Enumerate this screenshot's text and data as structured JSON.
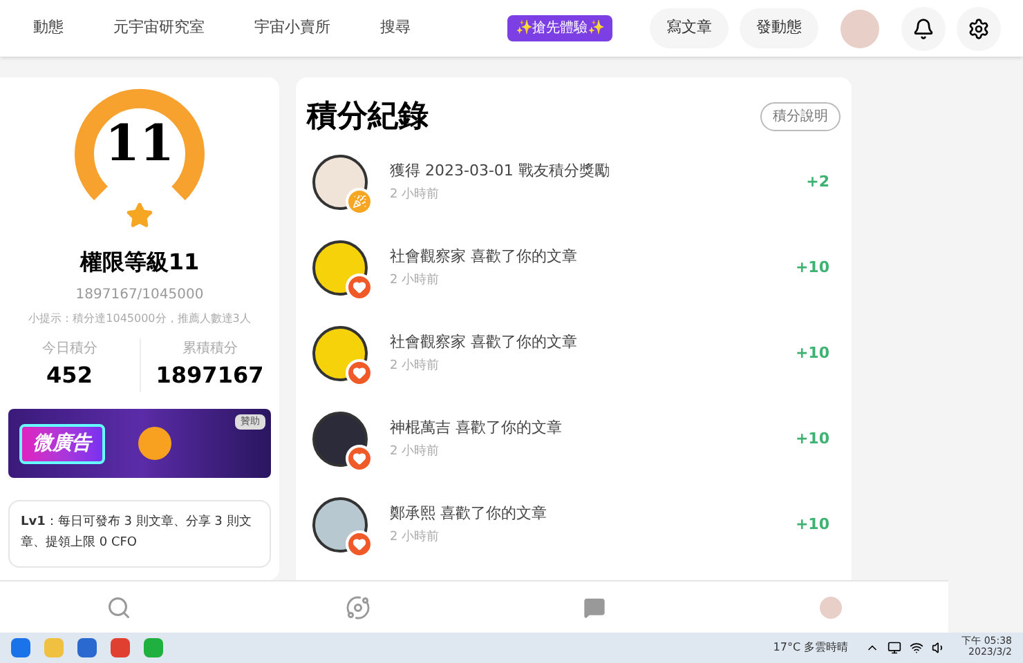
{
  "top_nav": {
    "links": [
      {
        "label": "動態",
        "selected": false
      },
      {
        "label": "元宇宙研究室",
        "selected": false
      },
      {
        "label": "宇宙小賣所",
        "selected": false
      },
      {
        "label": "搜尋",
        "selected": false
      }
    ],
    "promo_badge": "✨搶先體驗✨",
    "buttons": [
      "寫文章",
      "發動態"
    ]
  },
  "level_card": {
    "level_number": "11",
    "title": "權限等級11",
    "progress": "1897167/1045000",
    "hint": "小提示：積分達1045000分，推薦人數達3人",
    "stats": [
      {
        "label": "今日積分",
        "value": "452"
      },
      {
        "label": "累積積分",
        "value": "1897167"
      }
    ],
    "ad": {
      "title": "微廣告",
      "tag": "贊助"
    },
    "level_info": "**Lv1**：每日可發布 3 則文章、分享 3 則文章、提領上限 0 CFO"
  },
  "points_log": {
    "title": "積分紀錄",
    "help_button": "積分說明",
    "entries": [
      {
        "kind": "reward",
        "text": "獲得 2023-03-01 戰友積分獎勵",
        "time": "2 小時前",
        "points": "+2"
      },
      {
        "kind": "like",
        "text": "社會觀察家 喜歡了你的文章",
        "time": "2 小時前",
        "points": "+10"
      },
      {
        "kind": "like",
        "text": "社會觀察家 喜歡了你的文章",
        "time": "2 小時前",
        "points": "+10"
      },
      {
        "kind": "like",
        "text": "神棍萬吉 喜歡了你的文章",
        "time": "2 小時前",
        "points": "+10"
      },
      {
        "kind": "like",
        "text": "鄭承熙 喜歡了你的文章",
        "time": "2 小時前",
        "points": "+10"
      }
    ]
  },
  "taskbar": {
    "weather": "17°C 多雲時晴",
    "time": "下午 05:38",
    "date": "2023/3/2"
  }
}
